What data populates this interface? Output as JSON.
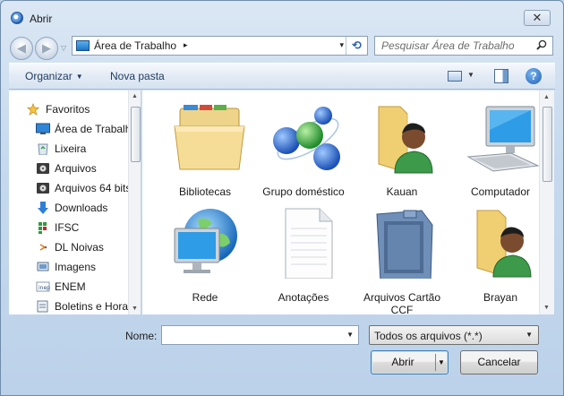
{
  "window": {
    "title": "Abrir",
    "close_label": "✕"
  },
  "address": {
    "location": "Área de Trabalho",
    "separator": "▸",
    "dropdown": "▾",
    "refresh": "⟲"
  },
  "search": {
    "placeholder": "Pesquisar Área de Trabalho"
  },
  "toolbar": {
    "organize_label": "Organizar",
    "organize_arrow": "▼",
    "new_folder_label": "Nova pasta",
    "view_arrow": "▼",
    "help": "?"
  },
  "sidebar": {
    "favorites_label": "Favoritos",
    "items": [
      {
        "label": "Área de Trabalho",
        "icon": "desktop-icon"
      },
      {
        "label": "Lixeira",
        "icon": "recycle-bin-icon"
      },
      {
        "label": "Arquivos",
        "icon": "drive-icon"
      },
      {
        "label": "Arquivos 64 bits",
        "icon": "drive-icon"
      },
      {
        "label": "Downloads",
        "icon": "download-icon"
      },
      {
        "label": "IFSC",
        "icon": "ifsc-icon"
      },
      {
        "label": "DL Noivas",
        "icon": "shortcut-icon"
      },
      {
        "label": "Imagens",
        "icon": "images-icon"
      },
      {
        "label": "ENEM",
        "icon": "enem-icon"
      },
      {
        "label": "Boletins e Hora",
        "icon": "document-icon"
      }
    ]
  },
  "files": [
    {
      "label": "Bibliotecas",
      "icon": "libraries-icon"
    },
    {
      "label": "Grupo doméstico",
      "icon": "homegroup-icon"
    },
    {
      "label": "Kauan",
      "icon": "user-folder-icon"
    },
    {
      "label": "Computador",
      "icon": "computer-icon"
    },
    {
      "label": "Rede",
      "icon": "network-icon"
    },
    {
      "label": "Anotações",
      "icon": "text-file-icon"
    },
    {
      "label": "Arquivos Cartão CCF",
      "icon": "memory-card-icon"
    },
    {
      "label": "Brayan",
      "icon": "user-folder-icon"
    }
  ],
  "footer": {
    "name_label": "Nome:",
    "name_value": "",
    "filter_value": "Todos os arquivos (*.*)",
    "open_label": "Abrir",
    "cancel_label": "Cancelar",
    "dropdown": "▼"
  }
}
